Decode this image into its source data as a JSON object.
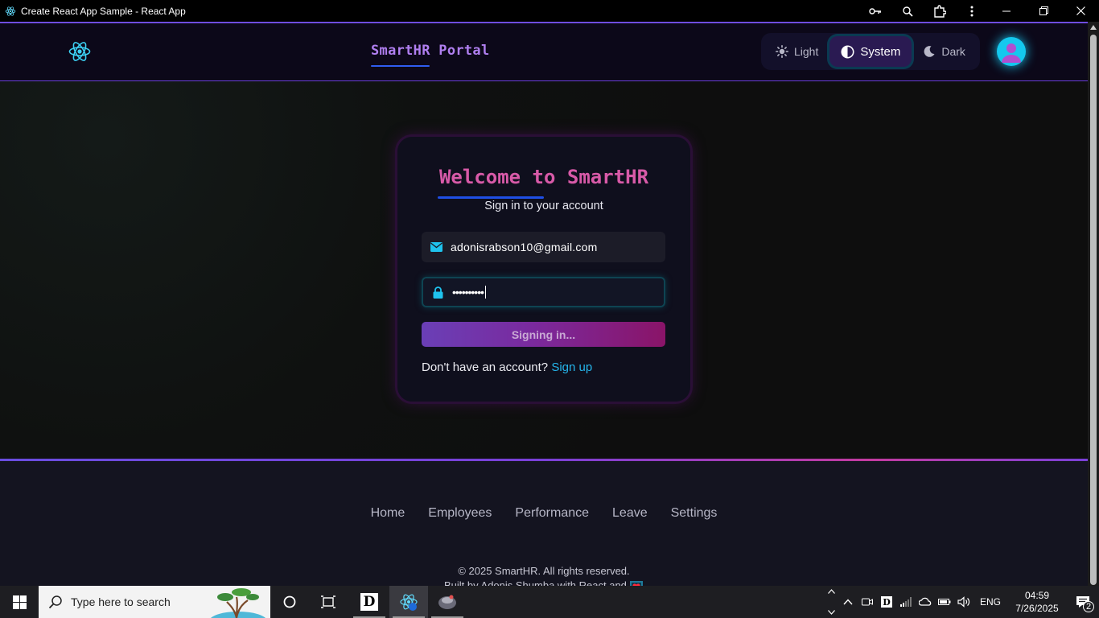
{
  "window": {
    "title": "Create React App Sample - React App"
  },
  "header": {
    "brand": "SmartHR Portal",
    "theme": {
      "options": [
        {
          "label": "Light",
          "icon": "sun-icon"
        },
        {
          "label": "System",
          "icon": "contrast-icon",
          "active": true
        },
        {
          "label": "Dark",
          "icon": "moon-icon"
        }
      ]
    }
  },
  "login": {
    "title": "Welcome to SmartHR",
    "subtitle": "Sign in to your account",
    "email_value": "adonisrabson10@gmail.com",
    "password_value": "••••••••••",
    "submit_label": "Signing in...",
    "signup_prompt": "Don't have an account?",
    "signup_link": "Sign up"
  },
  "footer": {
    "nav": [
      "Home",
      "Employees",
      "Performance",
      "Leave",
      "Settings"
    ],
    "copyright": "© 2025 SmartHR. All rights reserved.",
    "built_by": "Built by Adonis Shumba with React and"
  },
  "taskbar": {
    "search_placeholder": "Type here to search",
    "language": "ENG",
    "time": "04:59",
    "date": "7/26/2025",
    "notification_count": "2"
  },
  "colors": {
    "accent_purple": "#6a3fd8",
    "brand_pink": "#d85aa8",
    "link_cyan": "#25b4ea",
    "avatar_cyan": "#14c8ee"
  }
}
